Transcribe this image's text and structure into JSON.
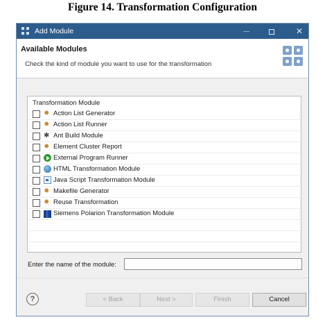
{
  "figure_caption": "Figure 14. Transformation Configuration",
  "window": {
    "title": "Add Module",
    "controls": {
      "minimize_icon": "minimize-icon",
      "maximize_icon": "maximize-icon",
      "close_symbol": "✕"
    }
  },
  "header": {
    "title": "Available Modules",
    "description": "Check the kind of module you want to use for the transformation"
  },
  "panel": {
    "column_header": "Transformation Module",
    "modules": [
      {
        "label": "Action List Generator",
        "icon": "gear-icon",
        "checked": false
      },
      {
        "label": "Action List Runner",
        "icon": "gear-icon",
        "checked": false
      },
      {
        "label": "Ant Build Module",
        "icon": "ant-icon",
        "checked": false
      },
      {
        "label": "Element Cluster Report",
        "icon": "gear-icon",
        "checked": false
      },
      {
        "label": "External Program Runner",
        "icon": "run-icon",
        "checked": false
      },
      {
        "label": "HTML Transformation Module",
        "icon": "globe-icon",
        "checked": false
      },
      {
        "label": "Java Script Transformation Module",
        "icon": "script-icon",
        "checked": false
      },
      {
        "label": "Makefile Generator",
        "icon": "gear-icon",
        "checked": false
      },
      {
        "label": "Reuse Transformation",
        "icon": "gear-icon",
        "checked": false
      },
      {
        "label": "Siemens Polarion Transformation Module",
        "icon": "siemens-icon",
        "checked": false
      }
    ]
  },
  "name_field": {
    "label": "Enter the name of the module:",
    "value": "",
    "placeholder": ""
  },
  "buttons": {
    "help": "?",
    "back": "< Back",
    "next": "Next >",
    "finish": "Finish",
    "cancel": "Cancel"
  },
  "colors": {
    "titlebar": "#2c5c8c",
    "banner_icon": "#7fa1cb"
  }
}
